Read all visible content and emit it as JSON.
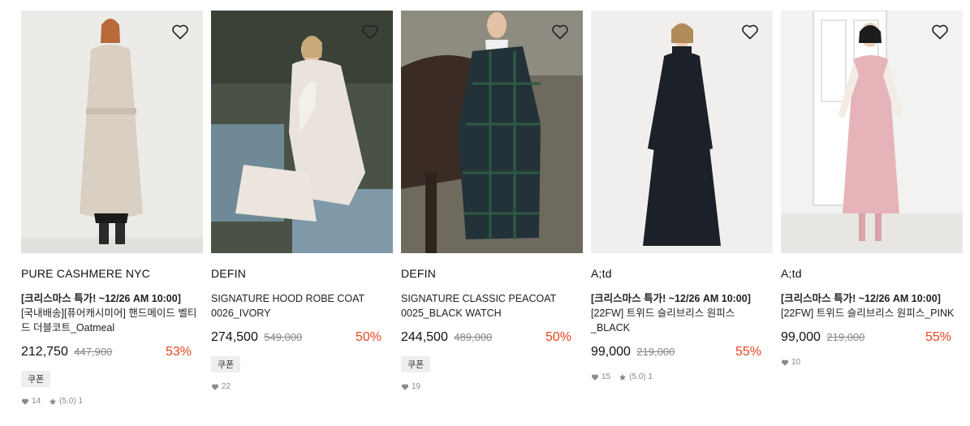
{
  "products": [
    {
      "brand": "PURE CASHMERE NYC",
      "promo": "[크리스마스 특가! ~12/26 AM 10:00]",
      "name": "[국내배송][퓨어캐시미어] 핸드메이드 벨티드 더블코트_Oatmeal",
      "price": "212,750",
      "original_price": "447,900",
      "discount": "53%",
      "coupon": "쿠폰",
      "likes": "14",
      "rating": "(5.0) 1"
    },
    {
      "brand": "DEFIN",
      "name": "SIGNATURE HOOD ROBE COAT 0026_IVORY",
      "price": "274,500",
      "original_price": "549,000",
      "discount": "50%",
      "coupon": "쿠폰",
      "likes": "22"
    },
    {
      "brand": "DEFIN",
      "name": "SIGNATURE CLASSIC PEACOAT 0025_BLACK WATCH",
      "price": "244,500",
      "original_price": "489,000",
      "discount": "50%",
      "coupon": "쿠폰",
      "likes": "19"
    },
    {
      "brand": "A;td",
      "promo": "[크리스마스 특가! ~12/26 AM 10:00]",
      "name": "[22FW] 트위드 슬리브리스 원피스_BLACK",
      "price": "99,000",
      "original_price": "219,000",
      "discount": "55%",
      "likes": "15",
      "rating": "(5.0) 1"
    },
    {
      "brand": "A;td",
      "promo": "[크리스마스 특가! ~12/26 AM 10:00]",
      "name": "[22FW] 트위드 슬리브리스 원피스_PINK",
      "price": "99,000",
      "original_price": "219,000",
      "discount": "55%",
      "likes": "10"
    }
  ],
  "colors": {
    "discount": "#e8441e",
    "muted": "#8a8a8a"
  },
  "icons": {
    "wishlist": "heart-outline-icon",
    "likes": "heart-icon",
    "rating": "star-icon"
  }
}
